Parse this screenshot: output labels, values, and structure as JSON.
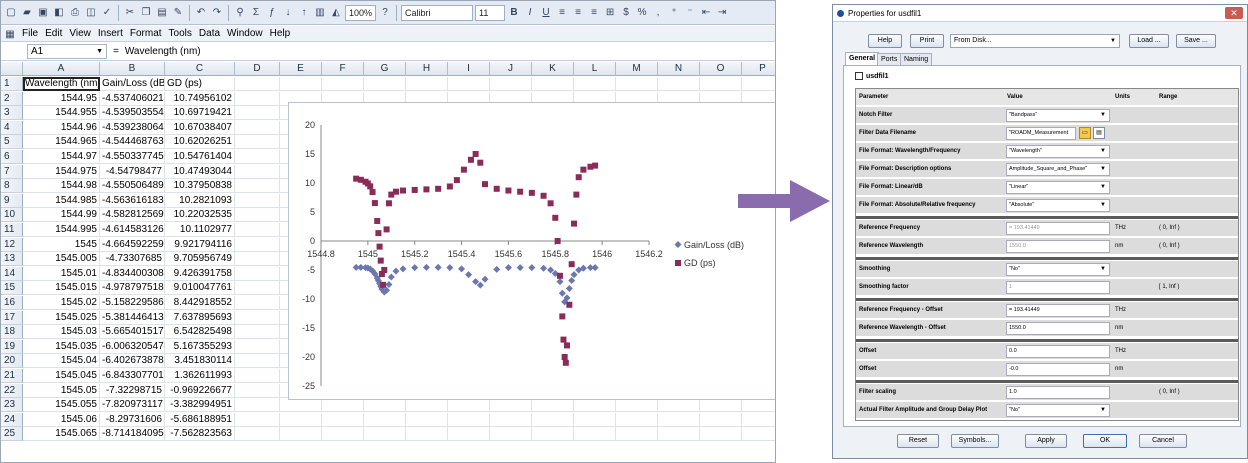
{
  "excel": {
    "toolbar": {
      "zoom": "100%",
      "font": "Calibri",
      "size": "11"
    },
    "menu": [
      "File",
      "Edit",
      "View",
      "Insert",
      "Format",
      "Tools",
      "Data",
      "Window",
      "Help"
    ],
    "name_box": "A1",
    "formula": "Wavelength (nm)",
    "columns": [
      "A",
      "B",
      "C",
      "D",
      "E",
      "F",
      "G",
      "H",
      "I",
      "J",
      "K",
      "L",
      "M",
      "N",
      "O",
      "P"
    ],
    "rows": [
      [
        "Wavelength (nm)",
        "Gain/Loss (dB)",
        "GD (ps)"
      ],
      [
        "1544.95",
        "-4.537406021",
        "10.74956102"
      ],
      [
        "1544.955",
        "-4.539503554",
        "10.69719421"
      ],
      [
        "1544.96",
        "-4.539238064",
        "10.67038407"
      ],
      [
        "1544.965",
        "-4.544468763",
        "10.62026251"
      ],
      [
        "1544.97",
        "-4.550337745",
        "10.54761404"
      ],
      [
        "1544.975",
        "-4.54798477",
        "10.47493044"
      ],
      [
        "1544.98",
        "-4.550506489",
        "10.37950838"
      ],
      [
        "1544.985",
        "-4.563616183",
        "10.2821093"
      ],
      [
        "1544.99",
        "-4.582812569",
        "10.22032535"
      ],
      [
        "1544.995",
        "-4.614583126",
        "10.1102977"
      ],
      [
        "1545",
        "-4.664592259",
        "9.921794116"
      ],
      [
        "1545.005",
        "-4.73307685",
        "9.705956749"
      ],
      [
        "1545.01",
        "-4.834400308",
        "9.426391758"
      ],
      [
        "1545.015",
        "-4.978797518",
        "9.010047761"
      ],
      [
        "1545.02",
        "-5.158229586",
        "8.442918552"
      ],
      [
        "1545.025",
        "-5.381446413",
        "7.637895693"
      ],
      [
        "1545.03",
        "-5.665401517",
        "6.542825498"
      ],
      [
        "1545.035",
        "-6.006320547",
        "5.167355293"
      ],
      [
        "1545.04",
        "-6.402673878",
        "3.451830114"
      ],
      [
        "1545.045",
        "-6.843307701",
        "1.362611993"
      ],
      [
        "1545.05",
        "-7.32298715",
        "-0.969226677"
      ],
      [
        "1545.055",
        "-7.820973117",
        "-3.382994951"
      ],
      [
        "1545.06",
        "-8.29731606",
        "-5.686188951"
      ],
      [
        "1545.065",
        "-8.714184095",
        "-7.562823563"
      ]
    ]
  },
  "chart_data": {
    "type": "scatter",
    "xlim": [
      1544.8,
      1546.2
    ],
    "ylim": [
      -25,
      20
    ],
    "x_ticks": [
      "1544.8",
      "1545",
      "1545.2",
      "1545.4",
      "1545.6",
      "1545.8",
      "1546",
      "1546.2"
    ],
    "y_ticks": [
      "20",
      "15",
      "10",
      "5",
      "0",
      "-5",
      "-10",
      "-15",
      "-20",
      "-25"
    ],
    "legend_position": "right",
    "series": [
      {
        "name": "Gain/Loss (dB)",
        "color": "#6b78b0",
        "marker": "diamond",
        "x": [
          1544.95,
          1544.97,
          1544.99,
          1545.0,
          1545.01,
          1545.02,
          1545.03,
          1545.04,
          1545.045,
          1545.05,
          1545.055,
          1545.06,
          1545.07,
          1545.08,
          1545.09,
          1545.1,
          1545.12,
          1545.15,
          1545.2,
          1545.25,
          1545.3,
          1545.35,
          1545.4,
          1545.43,
          1545.46,
          1545.48,
          1545.5,
          1545.55,
          1545.6,
          1545.65,
          1545.7,
          1545.75,
          1545.78,
          1545.8,
          1545.82,
          1545.83,
          1545.84,
          1545.85,
          1545.86,
          1545.87,
          1545.88,
          1545.9,
          1545.92,
          1545.95,
          1545.97
        ],
        "y": [
          -4.54,
          -4.55,
          -4.58,
          -4.66,
          -4.83,
          -5.16,
          -5.67,
          -6.4,
          -6.84,
          -7.32,
          -7.82,
          -8.3,
          -8.8,
          -8.5,
          -7.5,
          -6.2,
          -5.2,
          -4.8,
          -4.6,
          -4.55,
          -4.55,
          -4.6,
          -4.8,
          -5.8,
          -7.0,
          -7.6,
          -6.6,
          -4.9,
          -4.6,
          -4.6,
          -4.6,
          -4.7,
          -5.0,
          -5.6,
          -7.0,
          -9.0,
          -10.5,
          -9.8,
          -8.2,
          -6.8,
          -5.8,
          -5.0,
          -4.7,
          -4.6,
          -4.6
        ]
      },
      {
        "name": "GD (ps)",
        "color": "#8a2c5a",
        "marker": "square",
        "x": [
          1544.95,
          1544.97,
          1544.99,
          1545.0,
          1545.01,
          1545.02,
          1545.03,
          1545.04,
          1545.045,
          1545.05,
          1545.055,
          1545.06,
          1545.065,
          1545.07,
          1545.08,
          1545.09,
          1545.1,
          1545.12,
          1545.15,
          1545.2,
          1545.25,
          1545.3,
          1545.35,
          1545.38,
          1545.41,
          1545.44,
          1545.46,
          1545.48,
          1545.5,
          1545.55,
          1545.6,
          1545.65,
          1545.7,
          1545.75,
          1545.78,
          1545.8,
          1545.81,
          1545.82,
          1545.83,
          1545.835,
          1545.84,
          1545.845,
          1545.85,
          1545.86,
          1545.87,
          1545.88,
          1545.89,
          1545.9,
          1545.92,
          1545.95,
          1545.97
        ],
        "y": [
          10.75,
          10.55,
          10.22,
          9.92,
          9.43,
          8.44,
          6.54,
          3.45,
          1.36,
          -0.97,
          -3.38,
          -5.69,
          -7.56,
          -5.0,
          2.0,
          6.5,
          8.0,
          8.5,
          8.7,
          8.8,
          8.9,
          9.0,
          9.4,
          10.5,
          12.3,
          14.0,
          15.0,
          13.5,
          9.8,
          9.0,
          8.7,
          8.5,
          8.3,
          7.8,
          6.5,
          4.0,
          0.0,
          -6.0,
          -13.0,
          -17.0,
          -20.0,
          -21.0,
          -18.0,
          -11.0,
          -4.0,
          3.0,
          8.0,
          11.0,
          12.3,
          12.8,
          13.0
        ]
      }
    ]
  },
  "dialog": {
    "title": "Properties for usdfil1",
    "buttons_top": {
      "help": "Help",
      "print": "Print",
      "from_disk": "From Disk...",
      "load": "Load ...",
      "save": "Save ..."
    },
    "tabs": [
      "General",
      "Ports",
      "Naming"
    ],
    "component": "usdfil1",
    "headers": {
      "parameter": "Parameter",
      "value": "Value",
      "units": "Units",
      "range": "Range"
    },
    "params": [
      {
        "name": "Notch Filter",
        "value": "\"Bandpass\"",
        "units": "",
        "range": "",
        "dd": true
      },
      {
        "name": "Filter Data Filename",
        "value": "\"ROADM_Measurement",
        "units": "",
        "range": "",
        "file": true
      },
      {
        "name": "File Format: Wavelength/Frequency",
        "value": "\"Wavelength\"",
        "units": "",
        "range": "",
        "dd": true
      },
      {
        "name": "File Format: Description options",
        "value": "Amplitude_Square_and_Phase\"",
        "units": "",
        "range": "",
        "dd": true
      },
      {
        "name": "File Format: Linear/dB",
        "value": "\"Linear\"",
        "units": "",
        "range": "",
        "dd": true
      },
      {
        "name": "File Format: Absolute/Relative frequency",
        "value": "\"Absolute\"",
        "units": "",
        "range": "",
        "dd": true
      },
      {
        "sep": true
      },
      {
        "name": "Reference Frequency",
        "value": "= 193.41449",
        "units": "THz",
        "range": "( 0, Inf )",
        "dis": true
      },
      {
        "name": "Reference Wavelength",
        "value": "1550.0",
        "units": "nm",
        "range": "( 0, Inf )",
        "dis": true
      },
      {
        "sep": true
      },
      {
        "name": "Smoothing",
        "value": "\"No\"",
        "units": "",
        "range": "",
        "dd": true
      },
      {
        "name": "Smoothing factor",
        "value": "1",
        "units": "",
        "range": "[ 1, Inf )",
        "dis": true
      },
      {
        "sep": true
      },
      {
        "name": "Reference Frequency - Offset",
        "value": "= 193.41449",
        "units": "THz",
        "range": ""
      },
      {
        "name": "Reference Wavelength - Offset",
        "value": "1550.0",
        "units": "nm",
        "range": ""
      },
      {
        "sep": true
      },
      {
        "name": "Offset",
        "value": "0.0",
        "units": "THz",
        "range": ""
      },
      {
        "name": "Offset",
        "value": "-0.0",
        "units": "nm",
        "range": ""
      },
      {
        "sep": true
      },
      {
        "name": "Filter scaling",
        "value": "1.0",
        "units": "",
        "range": "( 0, Inf )"
      },
      {
        "name": "Actual Filter Amplitude and Group Delay Plot",
        "value": "\"No\"",
        "units": "",
        "range": "",
        "dd": true
      }
    ],
    "buttons_bottom": {
      "reset": "Reset",
      "symbols": "Symbols...",
      "apply": "Apply",
      "ok": "OK",
      "cancel": "Cancel"
    }
  }
}
